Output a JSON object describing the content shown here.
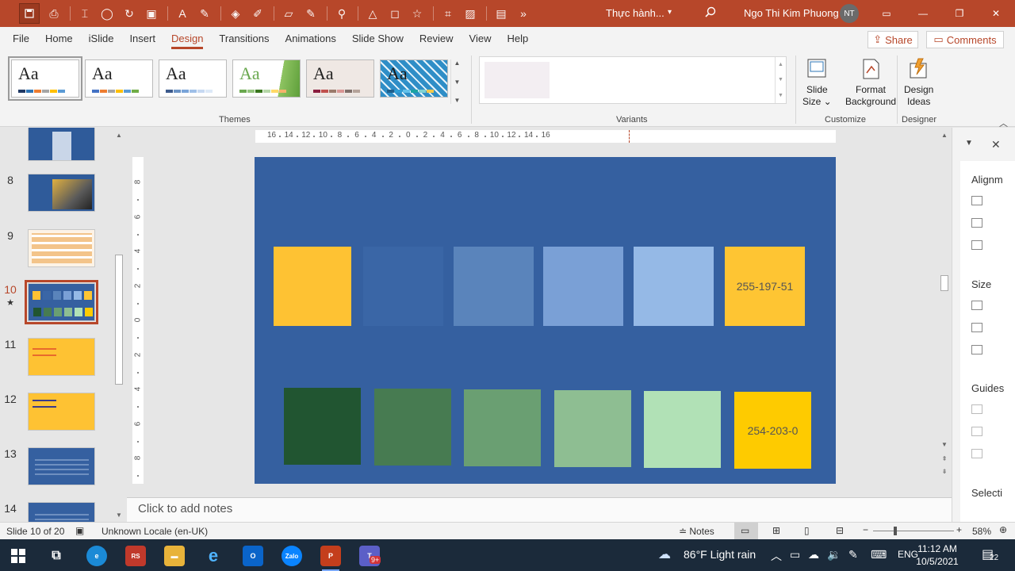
{
  "titlebar": {
    "doc_title": "Thực hành...",
    "user_name": "Ngo Thi Kim Phuong",
    "user_initials": "NT"
  },
  "tabs": [
    "File",
    "Home",
    "iSlide",
    "Insert",
    "Design",
    "Transitions",
    "Animations",
    "Slide Show",
    "Review",
    "View",
    "Help"
  ],
  "active_tab": "Design",
  "share_label": "Share",
  "comments_label": "Comments",
  "ribbon": {
    "themes": [
      {
        "aa": "Aa",
        "bg": "#ffffff",
        "fg": "#222222",
        "bars": [
          "#1f3864",
          "#2e75b6",
          "#ed7d31",
          "#a5a5a5",
          "#ffc000",
          "#5b9bd5"
        ]
      },
      {
        "aa": "Aa",
        "bg": "#ffffff",
        "fg": "#222222",
        "bars": [
          "#4472c4",
          "#ed7d31",
          "#a5a5a5",
          "#ffc000",
          "#5b9bd5",
          "#70ad47"
        ]
      },
      {
        "aa": "Aa",
        "bg": "#ffffff",
        "fg": "#222222",
        "bars": [
          "#3c5a8c",
          "#6b93c5",
          "#7aa4d9",
          "#9fc0e8",
          "#c7d9f2",
          "#dde9f7"
        ]
      },
      {
        "aa": "Aa",
        "bg": "#ffffff",
        "fg": "#6aa84f",
        "bars": [
          "#6aa84f",
          "#93c47d",
          "#38761d",
          "#b6d7a8",
          "#ffd966",
          "#f6b26b"
        ]
      },
      {
        "aa": "Aa",
        "bg": "#efe8e4",
        "fg": "#222222",
        "bars": [
          "#8b1e3f",
          "#c0504d",
          "#9b7a6b",
          "#d99694",
          "#7f6f6a",
          "#b5a39a"
        ]
      },
      {
        "aa": "Aa",
        "bg": "#3a8fc4",
        "fg": "#1a1a1a",
        "bars": [
          "#1f5f8b",
          "#2f9ed5",
          "#62c1ea",
          "#1aa3a3",
          "#7fd2d2",
          "#f2c94c"
        ]
      }
    ],
    "groups": {
      "themes": "Themes",
      "variants": "Variants",
      "customize": "Customize",
      "designer": "Designer"
    },
    "buttons": {
      "slide_size": [
        "Slide",
        "Size ⌄"
      ],
      "format_background": [
        "Format",
        "Background"
      ],
      "design_ideas": [
        "Design",
        "Ideas"
      ]
    }
  },
  "slides": [
    {
      "num": "8",
      "kind": "photo"
    },
    {
      "num": "9",
      "kind": "table"
    },
    {
      "num": "10",
      "kind": "swatches",
      "current": true,
      "starred": true
    },
    {
      "num": "11",
      "kind": "yellow"
    },
    {
      "num": "12",
      "kind": "yellow2"
    },
    {
      "num": "13",
      "kind": "blue"
    },
    {
      "num": "14",
      "kind": "blue"
    }
  ],
  "ruler": {
    "h_labels": [
      "16",
      "14",
      "12",
      "10",
      "8",
      "6",
      "4",
      "2",
      "0",
      "2",
      "4",
      "6",
      "8",
      "10",
      "12",
      "14",
      "16"
    ],
    "v_labels": [
      "8",
      "6",
      "4",
      "2",
      "0",
      "2",
      "4",
      "6",
      "8"
    ]
  },
  "slide_swatches": {
    "row1": [
      {
        "color": "#fec233",
        "label": ""
      },
      {
        "color": "#3a66a6",
        "label": ""
      },
      {
        "color": "#5a84bb",
        "label": ""
      },
      {
        "color": "#7aa0d6",
        "label": ""
      },
      {
        "color": "#95b9e6",
        "label": ""
      },
      {
        "color": "#fec533",
        "label": "255-197-51"
      }
    ],
    "row2": [
      {
        "color": "#215531",
        "label": ""
      },
      {
        "color": "#477b51",
        "label": ""
      },
      {
        "color": "#6a9f72",
        "label": ""
      },
      {
        "color": "#8ebe92",
        "label": ""
      },
      {
        "color": "#b1e1b6",
        "label": ""
      },
      {
        "color": "#fecb00",
        "label": "254-203-0"
      }
    ]
  },
  "notes_placeholder": "Click to add notes",
  "taskpane": {
    "alignment": "Alignm",
    "size": "Size",
    "guides": "Guides",
    "selection": "Selecti"
  },
  "statusbar": {
    "slide_info": "Slide 10 of 20",
    "locale": "Unknown Locale (en-UK)",
    "notes_label": "Notes",
    "zoom": "58%"
  },
  "taskbar": {
    "weather": "86°F  Light rain",
    "lang": "ENG",
    "time": "11:12 AM",
    "date": "10/5/2021",
    "notif_count": "22",
    "teams_badge": "9+"
  }
}
